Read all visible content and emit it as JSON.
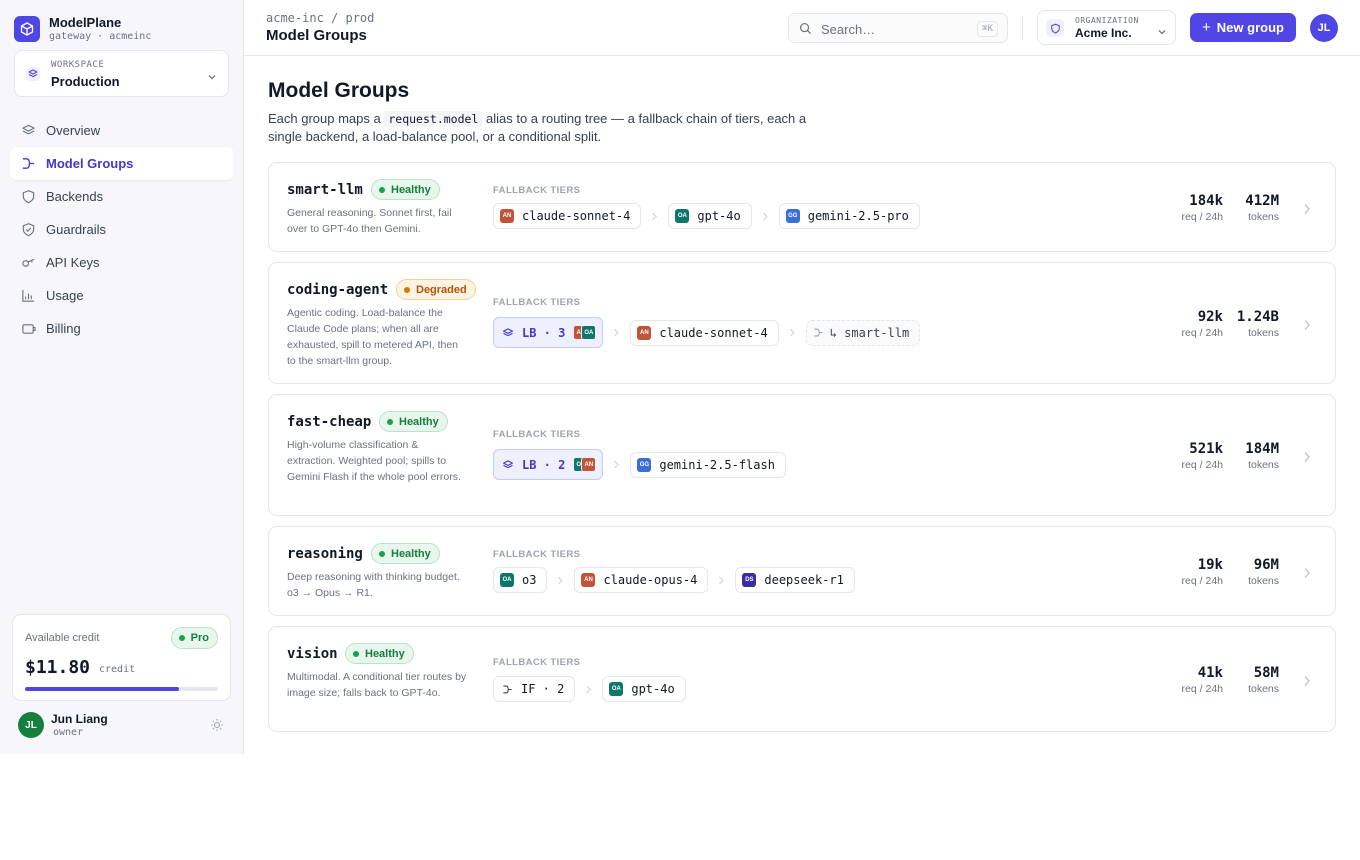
{
  "brand": {
    "name": "ModelPlane",
    "sub": "gateway · acmeinc"
  },
  "workspace": {
    "label": "WORKSPACE",
    "value": "Production"
  },
  "sidebar": {
    "items": [
      {
        "label": "Overview",
        "icon": "layers-icon",
        "active": false
      },
      {
        "label": "Model Groups",
        "icon": "route-icon",
        "active": true
      },
      {
        "label": "Backends",
        "icon": "shield-icon",
        "active": false
      },
      {
        "label": "Guardrails",
        "icon": "shield-check-icon",
        "active": false
      },
      {
        "label": "API Keys",
        "icon": "key-icon",
        "active": false
      },
      {
        "label": "Usage",
        "icon": "bar-chart-icon",
        "active": false
      },
      {
        "label": "Billing",
        "icon": "wallet-icon",
        "active": false
      }
    ]
  },
  "credit": {
    "label": "Available credit",
    "badge": "Pro",
    "amount": "$11.80",
    "unit": "credit",
    "fill_fraction": 0.8
  },
  "user": {
    "initials": "JL",
    "name": "Jun Liang",
    "role": "owner"
  },
  "header": {
    "breadcrumb": "acme-inc / prod",
    "title": "Model Groups",
    "search_placeholder": "Search…",
    "search_shortcut": "⌘K",
    "org_label": "ORGANIZATION",
    "org_value": "Acme Inc.",
    "new_group_label": "New group",
    "avatar_initials": "JL"
  },
  "page": {
    "title": "Model Groups",
    "desc_before": "Each group maps a",
    "desc_code": "request.model",
    "desc_after": "alias to a routing tree — a fallback chain of tiers, each a single backend, a load-balance pool, or a conditional split."
  },
  "labels": {
    "fallback_tiers": "FALLBACK TIERS",
    "req_unit": "req / 24h",
    "tokens_unit": "tokens"
  },
  "colors": {
    "accent": "#4f46e5",
    "anthropic": "#c2543a",
    "openai": "#0f766e",
    "google": "#3b6fd4",
    "deepseek": "#3730a3",
    "healthy": "#15803d",
    "degraded": "#b45309"
  },
  "groups": [
    {
      "name": "smart-llm",
      "status": "Healthy",
      "status_kind": "healthy",
      "desc": "General reasoning. Sonnet first, fail over to GPT-4o then Gemini.",
      "requests": "184k",
      "tokens": "412M",
      "tiers": [
        {
          "kind": "model",
          "provider": "AN",
          "label": "claude-sonnet-4"
        },
        {
          "kind": "model",
          "provider": "OA",
          "label": "gpt-4o"
        },
        {
          "kind": "model",
          "provider": "GG",
          "label": "gemini-2.5-pro"
        }
      ]
    },
    {
      "name": "coding-agent",
      "status": "Degraded",
      "status_kind": "degraded",
      "desc": "Agentic coding. Load-balance the Claude Code plans; when all are exhausted, spill to metered API, then to the smart-llm group.",
      "requests": "92k",
      "tokens": "1.24B",
      "tiers": [
        {
          "kind": "lb",
          "label": "LB · 3",
          "providers": [
            "AN",
            "OA"
          ]
        },
        {
          "kind": "model",
          "provider": "AN",
          "label": "claude-sonnet-4"
        },
        {
          "kind": "ref",
          "label": "↳ smart-llm"
        }
      ]
    },
    {
      "name": "fast-cheap",
      "status": "Healthy",
      "status_kind": "healthy",
      "desc": "High-volume classification & extraction. Weighted pool; spills to Gemini Flash if the whole pool errors.",
      "requests": "521k",
      "tokens": "184M",
      "tiers": [
        {
          "kind": "lb",
          "label": "LB · 2",
          "providers": [
            "OA",
            "AN"
          ]
        },
        {
          "kind": "model",
          "provider": "GG",
          "label": "gemini-2.5-flash"
        }
      ]
    },
    {
      "name": "reasoning",
      "status": "Healthy",
      "status_kind": "healthy",
      "desc": "Deep reasoning with thinking budget. o3 → Opus → R1.",
      "requests": "19k",
      "tokens": "96M",
      "tiers": [
        {
          "kind": "model",
          "provider": "OA",
          "label": "o3"
        },
        {
          "kind": "model",
          "provider": "AN",
          "label": "claude-opus-4"
        },
        {
          "kind": "model",
          "provider": "DS",
          "label": "deepseek-r1"
        }
      ]
    },
    {
      "name": "vision",
      "status": "Healthy",
      "status_kind": "healthy",
      "desc": "Multimodal. A conditional tier routes by image size; falls back to GPT-4o.",
      "requests": "41k",
      "tokens": "58M",
      "tiers": [
        {
          "kind": "if",
          "label": "IF · 2"
        },
        {
          "kind": "model",
          "provider": "OA",
          "label": "gpt-4o"
        }
      ]
    }
  ]
}
